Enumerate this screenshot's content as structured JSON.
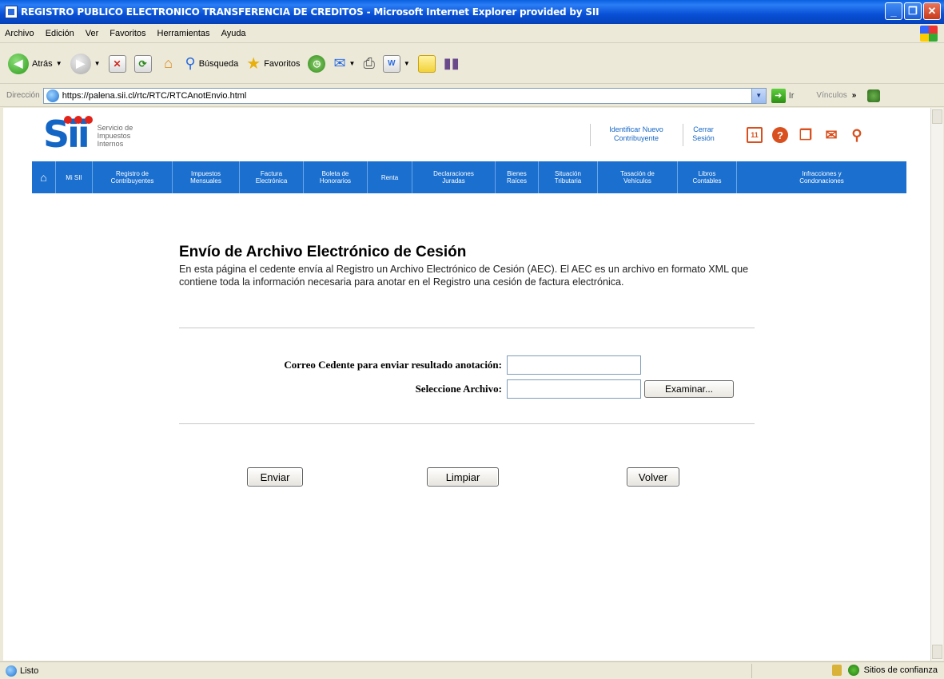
{
  "window": {
    "title": "REGISTRO PUBLICO ELECTRONICO TRANSFERENCIA DE CREDITOS - Microsoft Internet Explorer provided by SII"
  },
  "menubar": {
    "items": [
      "Archivo",
      "Edición",
      "Ver",
      "Favoritos",
      "Herramientas",
      "Ayuda"
    ]
  },
  "toolbar": {
    "back_label": "Atrás",
    "search_label": "Búsqueda",
    "favorites_label": "Favoritos"
  },
  "addressbar": {
    "label": "Dirección",
    "url": "https://palena.sii.cl/rtc/RTC/RTCAnotEnvio.html",
    "go_label": "Ir",
    "links_label": "Vínculos"
  },
  "sii": {
    "logo_text": "Sii",
    "logo_sub": [
      "Servicio de",
      "Impuestos",
      "Internos"
    ],
    "header_links": [
      {
        "l1": "Identificar Nuevo",
        "l2": "Contribuyente"
      },
      {
        "l1": "Cerrar",
        "l2": "Sesión"
      }
    ],
    "calendar_label": "11",
    "nav": [
      {
        "l1": "Mi SII",
        "l2": ""
      },
      {
        "l1": "Registro de",
        "l2": "Contribuyentes"
      },
      {
        "l1": "Impuestos",
        "l2": "Mensuales"
      },
      {
        "l1": "Factura",
        "l2": "Electrónica"
      },
      {
        "l1": "Boleta de",
        "l2": "Honorarios"
      },
      {
        "l1": "Renta",
        "l2": ""
      },
      {
        "l1": "Declaraciones",
        "l2": "Juradas"
      },
      {
        "l1": "Bienes",
        "l2": "Raíces"
      },
      {
        "l1": "Situación",
        "l2": "Tributaria"
      },
      {
        "l1": "Tasación de",
        "l2": "Vehículos"
      },
      {
        "l1": "Libros",
        "l2": "Contables"
      },
      {
        "l1": "Infracciones y",
        "l2": "Condonaciones"
      }
    ]
  },
  "main": {
    "title": "Envío de Archivo Electrónico de Cesión",
    "description": "En esta página el cedente envía al Registro un Archivo Electrónico de Cesión (AEC). El AEC es un archivo en formato XML que contiene toda la información necesaria para anotar en el Registro una cesión de factura electrónica."
  },
  "form": {
    "email_label": "Correo Cedente para enviar resultado anotación:",
    "email_value": "",
    "file_label": "Seleccione Archivo:",
    "file_value": "",
    "browse_label": "Examinar..."
  },
  "buttons": {
    "send": "Enviar",
    "clear": "Limpiar",
    "back": "Volver"
  },
  "statusbar": {
    "status": "Listo",
    "zone": "Sitios de confianza"
  }
}
